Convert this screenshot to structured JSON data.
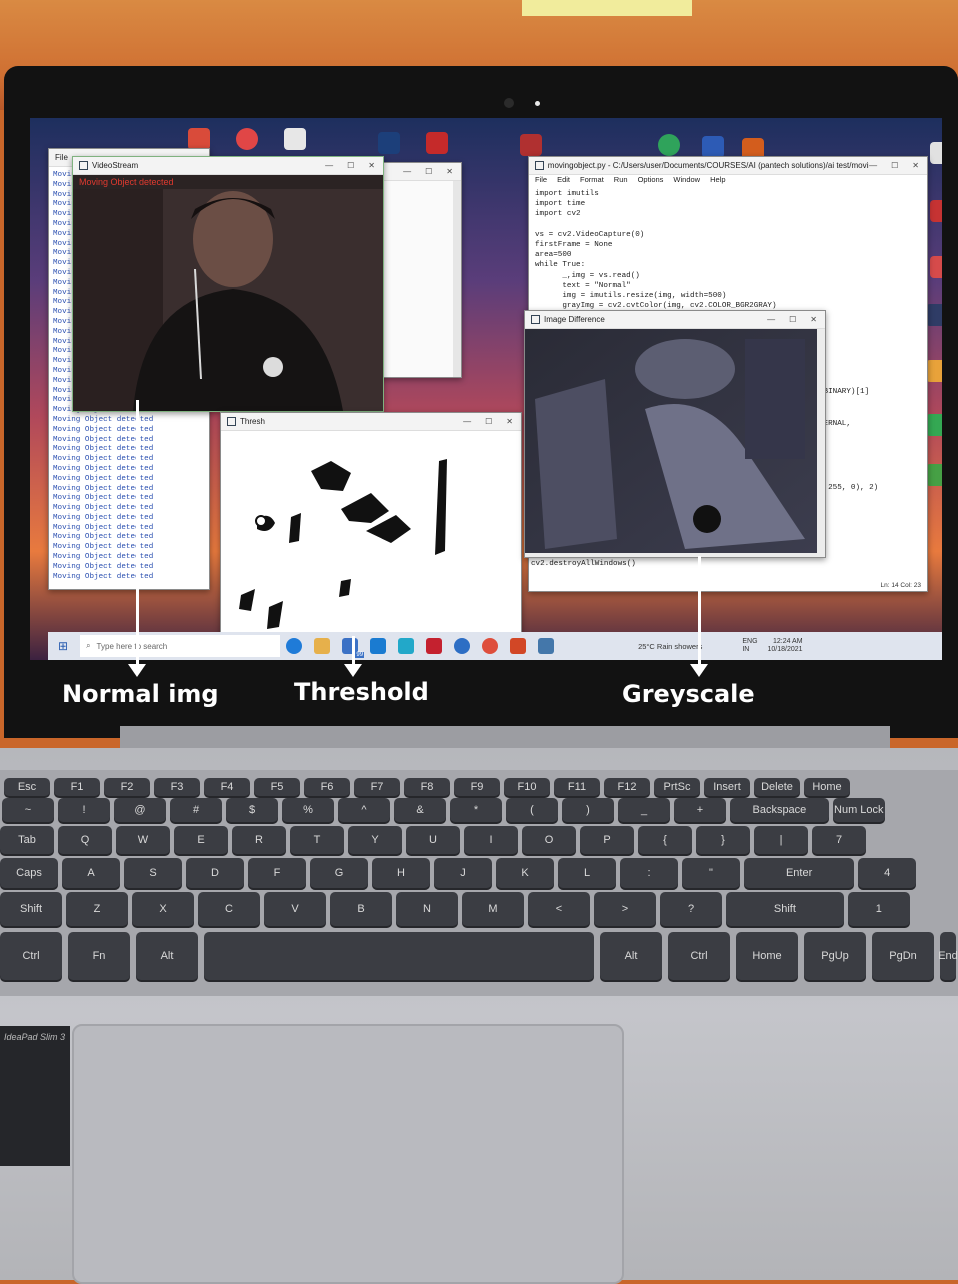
{
  "annotations": {
    "normal_label": "Normal img",
    "threshold_label": "Threshold",
    "greyscale_label": "Greyscale"
  },
  "windows": {
    "video": {
      "title": "VideoStream",
      "overlay": "Moving Object detected"
    },
    "thresh": {
      "title": "Thresh"
    },
    "diff": {
      "title": "Image Difference"
    },
    "editor": {
      "title": "movingobject.py - C:/Users/user/Documents/COURSES/AI (pantech solutions)/ai test/movin...",
      "menu": [
        "File",
        "Edit",
        "Format",
        "Run",
        "Options",
        "Window",
        "Help"
      ],
      "code_lines": [
        "import imutils",
        "import time",
        "import cv2",
        "",
        "vs = cv2.VideoCapture(0)",
        "firstFrame = None",
        "area=500",
        "while True:",
        "      _,img = vs.read()",
        "      text = \"Normal\"",
        "      img = imutils.resize(img, width=500)",
        "      grayImg = cv2.cvtColor(img, cv2.COLOR_BGR2GRAY)"
      ],
      "code_fragments": [
        "_BINARY)[1]",
        "TERNAL,",
        ", 255, 0), 2)"
      ],
      "code_tail": "cv2.destroyAllWindows()",
      "status": "Ln: 14   Col: 23"
    },
    "console": {
      "menu": "File",
      "line_text": "Moving Object detected",
      "line_short": "Moving"
    }
  },
  "taskbar": {
    "search_placeholder": "Type here to search",
    "weather": "25°C  Rain showers",
    "lang": "ENG",
    "lang2": "IN",
    "time": "12:24 AM",
    "date": "10/18/2021",
    "mail_badge": "99"
  },
  "keyboard": {
    "row_fn": [
      "Esc",
      "F1",
      "F2",
      "F3",
      "F4",
      "F5",
      "F6",
      "F7",
      "F8",
      "F9",
      "F10",
      "F11",
      "F12",
      "PrtSc",
      "Insert",
      "Delete",
      "Home"
    ],
    "row_num": [
      "~",
      "!",
      "@",
      "#",
      "$",
      "%",
      "^",
      "&",
      "*",
      "(",
      ")",
      "_",
      "+",
      "Backspace",
      "Num Lock"
    ],
    "row_q": [
      "Tab",
      "Q",
      "W",
      "E",
      "R",
      "T",
      "Y",
      "U",
      "I",
      "O",
      "P",
      "{",
      "}",
      "|",
      "7"
    ],
    "row_a": [
      "Caps",
      "A",
      "S",
      "D",
      "F",
      "G",
      "H",
      "J",
      "K",
      "L",
      ":",
      "\"",
      "Enter",
      "4"
    ],
    "row_z": [
      "Shift",
      "Z",
      "X",
      "C",
      "V",
      "B",
      "N",
      "M",
      "<",
      ">",
      "?",
      "Shift",
      "1"
    ],
    "row_space": [
      "Ctrl",
      "Fn",
      "Alt",
      "",
      "Alt",
      "Ctrl",
      "Home",
      "PgUp",
      "PgDn",
      "End"
    ]
  },
  "branding": {
    "model": "IdeaPad Slim 3"
  }
}
